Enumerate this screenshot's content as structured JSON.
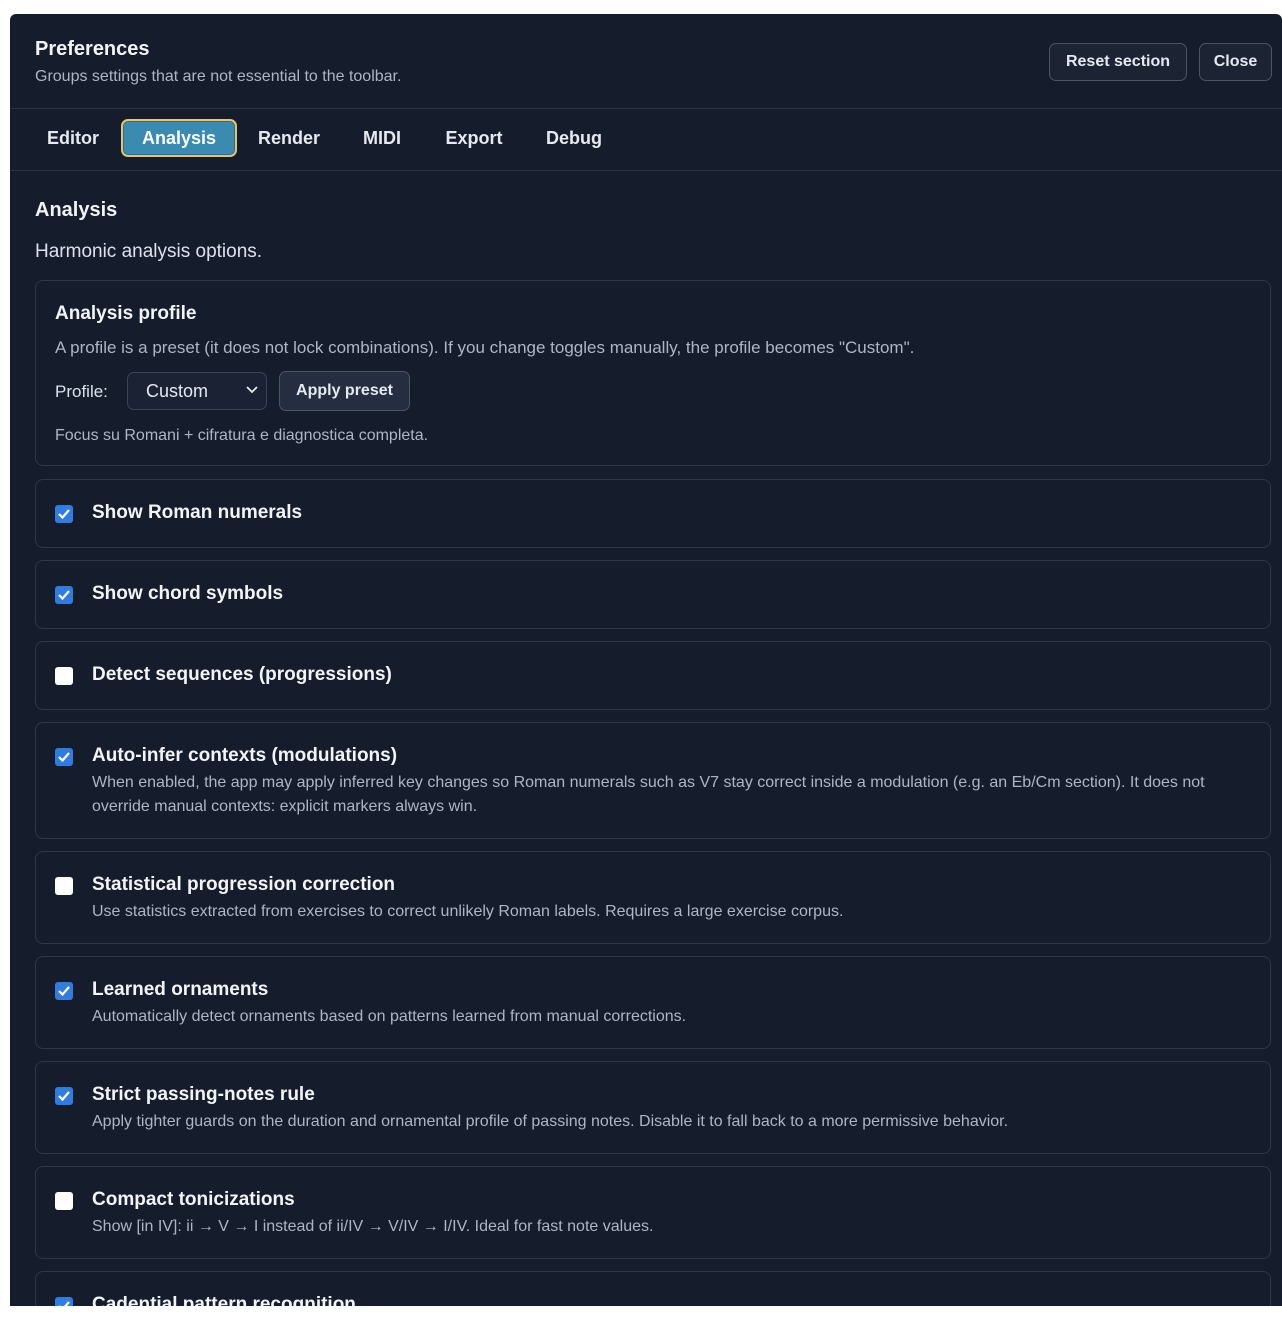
{
  "dialog": {
    "title": "Preferences",
    "subtitle": "Groups settings that are not essential to the toolbar.",
    "reset_label": "Reset section",
    "close_label": "Close"
  },
  "tabs": [
    {
      "label": "Editor",
      "active": false
    },
    {
      "label": "Analysis",
      "active": true
    },
    {
      "label": "Render",
      "active": false
    },
    {
      "label": "MIDI",
      "active": false
    },
    {
      "label": "Export",
      "active": false
    },
    {
      "label": "Debug",
      "active": false
    }
  ],
  "section": {
    "title": "Analysis",
    "description": "Harmonic analysis options."
  },
  "profile_card": {
    "title": "Analysis profile",
    "description": "A profile is a preset (it does not lock combinations). If you change toggles manually, the profile becomes \"Custom\".",
    "profile_label": "Profile:",
    "profile_value": "Custom",
    "apply_label": "Apply preset",
    "note": "Focus su Romani + cifratura e diagnostica completa."
  },
  "options": [
    {
      "label": "Show Roman numerals",
      "checked": true,
      "description": ""
    },
    {
      "label": "Show chord symbols",
      "checked": true,
      "description": ""
    },
    {
      "label": "Detect sequences (progressions)",
      "checked": false,
      "description": ""
    },
    {
      "label": "Auto-infer contexts (modulations)",
      "checked": true,
      "description": "When enabled, the app may apply inferred key changes so Roman numerals such as V7 stay correct inside a modulation (e.g. an Eb/Cm section). It does not override manual contexts: explicit markers always win."
    },
    {
      "label": "Statistical progression correction",
      "checked": false,
      "description": "Use statistics extracted from exercises to correct unlikely Roman labels. Requires a large exercise corpus."
    },
    {
      "label": "Learned ornaments",
      "checked": true,
      "description": "Automatically detect ornaments based on patterns learned from manual corrections."
    },
    {
      "label": "Strict passing-notes rule",
      "checked": true,
      "description": "Apply tighter guards on the duration and ornamental profile of passing notes. Disable it to fall back to a more permissive behavior."
    },
    {
      "label": "Compact tonicizations",
      "checked": false,
      "description": "Show [in IV]: ii → V → I instead of ii/IV → V/IV → I/IV. Ideal for fast note values."
    },
    {
      "label": "Cadential pattern recognition",
      "checked": true,
      "description": ""
    }
  ],
  "colors": {
    "dialog_bg": "#151c2b",
    "accent_tab": "#3b8ab0",
    "tab_focus_ring": "#e6c46a",
    "checkbox_on": "#2f7de1"
  }
}
